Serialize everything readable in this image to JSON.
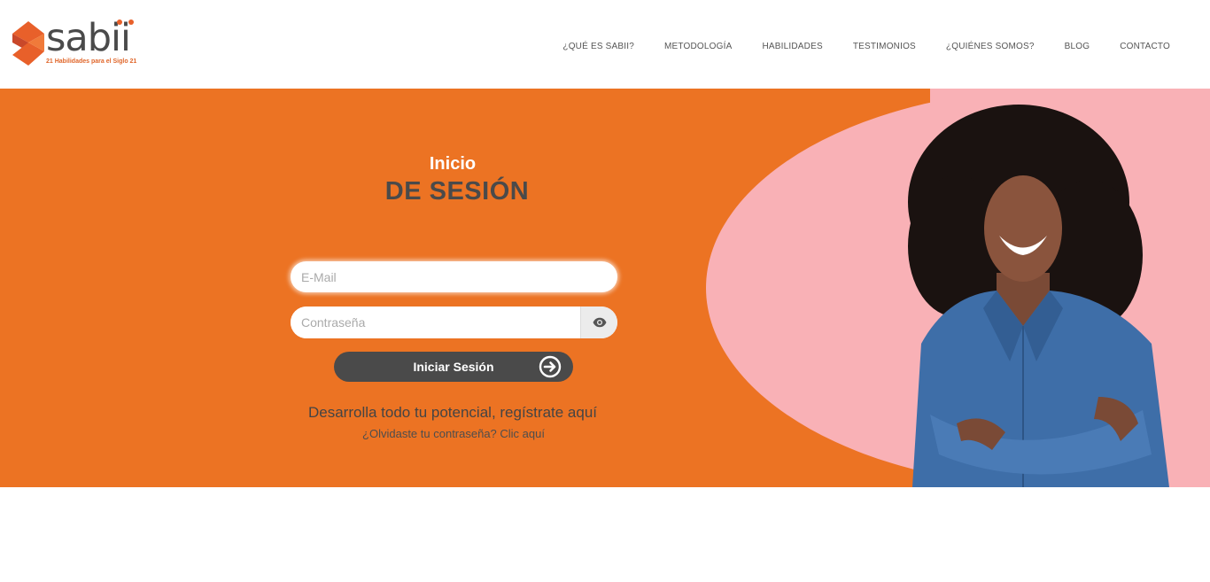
{
  "brand": {
    "name": "sabii",
    "tagline": "21 Habilidades para el Siglo 21",
    "accent_color": "#ec7323",
    "logo_red": "#e8602a"
  },
  "nav": {
    "items": [
      {
        "label": "¿QUÉ ES SABII?"
      },
      {
        "label": "METODOLOGÍA"
      },
      {
        "label": "HABILIDADES"
      },
      {
        "label": "TESTIMONIOS"
      },
      {
        "label": "¿QUIÉNES SOMOS?"
      },
      {
        "label": "BLOG"
      },
      {
        "label": "CONTACTO"
      }
    ]
  },
  "login": {
    "title_small": "Inicio",
    "title_big": "DE SESIÓN",
    "email_placeholder": "E-Mail",
    "email_value": "",
    "password_placeholder": "Contraseña",
    "password_value": "",
    "show_password_icon": "eye-icon",
    "submit_label": "Iniciar Sesión",
    "submit_icon": "arrow-right-circle-icon",
    "register_text": "Desarrolla todo tu potencial, regístrate aquí",
    "forgot_text": "¿Olvidaste tu contraseña? Clic aquí"
  },
  "hero": {
    "background_color": "#ec7323",
    "blob_color": "#f9b1b6",
    "image": "smiling-woman-photo"
  }
}
